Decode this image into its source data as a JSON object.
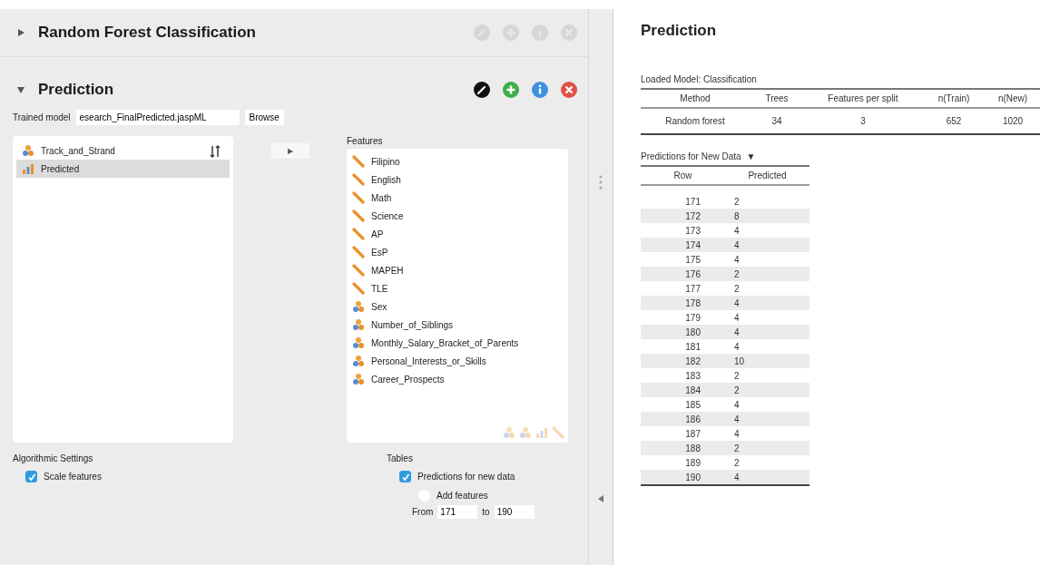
{
  "sections": [
    {
      "title": "Random Forest Classification",
      "expanded": false,
      "active": false
    },
    {
      "title": "Prediction",
      "expanded": true,
      "active": true
    }
  ],
  "trained_model": {
    "label": "Trained model",
    "value": "esearch_FinalPredicted.jaspML",
    "button": "Browse"
  },
  "variables": [
    {
      "name": "Track_and_Strand",
      "kind": "nominal",
      "selected": false
    },
    {
      "name": "Predicted",
      "kind": "ordinal",
      "selected": true
    }
  ],
  "move_button": "▶",
  "features": {
    "label": "Features",
    "items": [
      {
        "name": "Filipino",
        "kind": "scale"
      },
      {
        "name": "English",
        "kind": "scale"
      },
      {
        "name": "Math",
        "kind": "scale"
      },
      {
        "name": "Science",
        "kind": "scale"
      },
      {
        "name": "AP",
        "kind": "scale"
      },
      {
        "name": "EsP",
        "kind": "scale"
      },
      {
        "name": "MAPEH",
        "kind": "scale"
      },
      {
        "name": "TLE",
        "kind": "scale"
      },
      {
        "name": "Sex",
        "kind": "nominal"
      },
      {
        "name": "Number_of_Siblings",
        "kind": "nominal"
      },
      {
        "name": "Monthly_Salary_Bracket_of_Parents",
        "kind": "nominal"
      },
      {
        "name": "Personal_Interests_or_Skills",
        "kind": "nominal"
      },
      {
        "name": "Career_Prospects",
        "kind": "nominal"
      }
    ],
    "allowed_types": [
      {
        "kind": "nominal"
      },
      {
        "kind": "nominal"
      },
      {
        "kind": "ordinal"
      },
      {
        "kind": "scale"
      }
    ]
  },
  "algorithmic_settings": {
    "title": "Algorithmic Settings",
    "options": [
      {
        "label": "Scale features",
        "checked": true
      }
    ]
  },
  "tables_settings": {
    "title": "Tables",
    "options": [
      {
        "label": "Predictions for new data",
        "checked": true,
        "kind": "checkbox"
      },
      {
        "label": "Add features",
        "checked": false,
        "kind": "radio"
      }
    ],
    "from_label": "From",
    "from_value": "171",
    "to_label": "to",
    "to_value": "190"
  },
  "results": {
    "title": "Prediction",
    "model_table": {
      "caption": "Loaded Model: Classification",
      "columns": [
        "Method",
        "Trees",
        "Features per split",
        "n(Train)",
        "n(New)"
      ],
      "rows": [
        [
          "Random forest",
          "34",
          "3",
          "652",
          "1020"
        ]
      ]
    },
    "predictions_table": {
      "caption": "Predictions for New Data",
      "caption_icon": "▼",
      "columns": [
        "Row",
        "Predicted"
      ],
      "rows": [
        [
          "171",
          "2"
        ],
        [
          "172",
          "8"
        ],
        [
          "173",
          "4"
        ],
        [
          "174",
          "4"
        ],
        [
          "175",
          "4"
        ],
        [
          "176",
          "2"
        ],
        [
          "177",
          "2"
        ],
        [
          "178",
          "4"
        ],
        [
          "179",
          "4"
        ],
        [
          "180",
          "4"
        ],
        [
          "181",
          "4"
        ],
        [
          "182",
          "10"
        ],
        [
          "183",
          "2"
        ],
        [
          "184",
          "2"
        ],
        [
          "185",
          "4"
        ],
        [
          "186",
          "4"
        ],
        [
          "187",
          "4"
        ],
        [
          "188",
          "2"
        ],
        [
          "189",
          "2"
        ],
        [
          "190",
          "4"
        ]
      ]
    }
  }
}
